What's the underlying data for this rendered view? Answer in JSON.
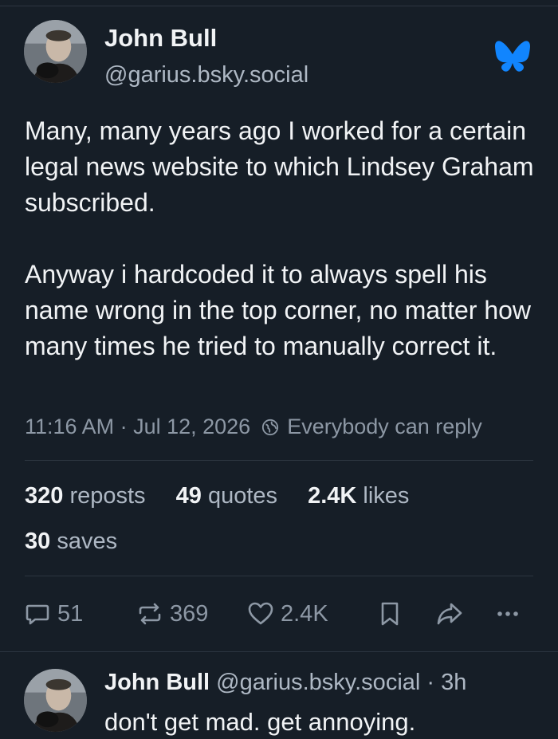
{
  "post": {
    "author_name": "John Bull",
    "author_handle": "@garius.bsky.social",
    "paragraph_1": "Many, many years ago I worked for a certain legal news website to which Lindsey Graham subscribed.",
    "paragraph_2": "Anyway i hardcoded it to always spell his name wrong in the top corner, no matter how many times he tried to manually correct it.",
    "timestamp": "11:16 AM · Jul 12, 2026",
    "reply_setting": "Everybody can reply"
  },
  "stats": {
    "reposts_count": "320",
    "reposts_label": "reposts",
    "quotes_count": "49",
    "quotes_label": "quotes",
    "likes_count": "2.4K",
    "likes_label": "likes",
    "saves_count": "30",
    "saves_label": "saves"
  },
  "actions": {
    "replies": "51",
    "reposts": "369",
    "likes": "2.4K"
  },
  "reply": {
    "author_name": "John Bull",
    "author_handle": "@garius.bsky.social",
    "age": "· 3h",
    "text": "don't get mad. get annoying."
  },
  "icons": {
    "brand": "bluesky-butterfly-icon",
    "reply_setting": "globe-icon",
    "reply": "speech-bubble-icon",
    "repost": "repost-arrows-icon",
    "like": "heart-icon",
    "save": "bookmark-icon",
    "share": "share-arrow-icon",
    "more": "ellipsis-icon"
  },
  "colors": {
    "background": "#161e27",
    "brand_blue": "#1185fe",
    "text_primary": "#f1f3f5",
    "text_secondary": "#8d98a5"
  }
}
